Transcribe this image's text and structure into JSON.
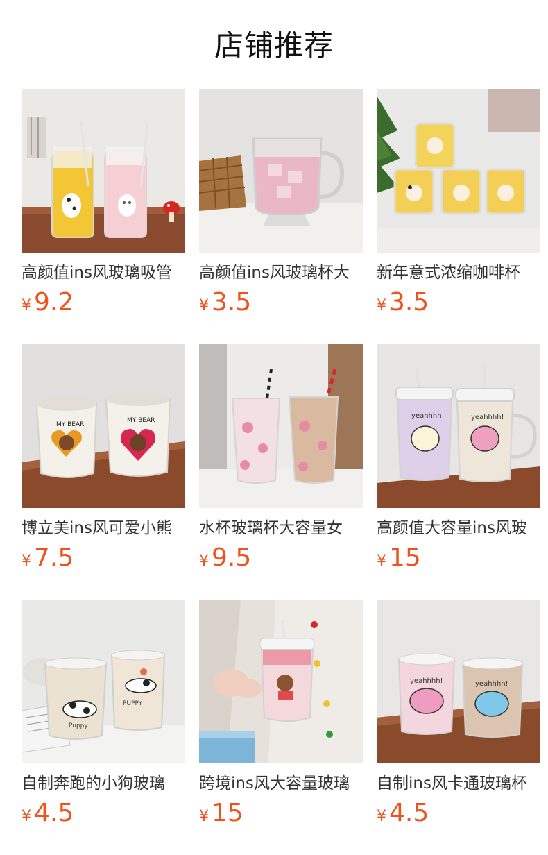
{
  "page": {
    "title": "店铺推荐",
    "currency": "¥"
  },
  "products": [
    {
      "name": "高颜值ins风玻璃吸管",
      "price": "9.2",
      "image": "two-carafes-yellow-pink-dog-cat-icon"
    },
    {
      "name": "高颜值ins风玻璃杯大",
      "price": "3.5",
      "image": "pink-ice-drink-mug-icon"
    },
    {
      "name": "新年意式浓缩咖啡杯",
      "price": "3.5",
      "image": "yellow-espresso-cups-bear-icon"
    },
    {
      "name": "博立美ins风可爱小熊",
      "price": "7.5",
      "image": "my-bear-ceramic-cups-icon"
    },
    {
      "name": "水杯玻璃杯大容量女",
      "price": "9.5",
      "image": "tall-pink-straw-glasses-icon"
    },
    {
      "name": "高颜值大容量ins风玻",
      "price": "15",
      "image": "lidded-mugs-yeahhhh-icon"
    },
    {
      "name": "自制奔跑的小狗玻璃",
      "price": "4.5",
      "image": "running-puppy-glasses-icon"
    },
    {
      "name": "跨境ins风大容量玻璃",
      "price": "15",
      "image": "held-straw-cup-bear-icon"
    },
    {
      "name": "自制ins风卡通玻璃杯",
      "price": "4.5",
      "image": "cartoon-glasses-pink-blue-icon"
    }
  ]
}
